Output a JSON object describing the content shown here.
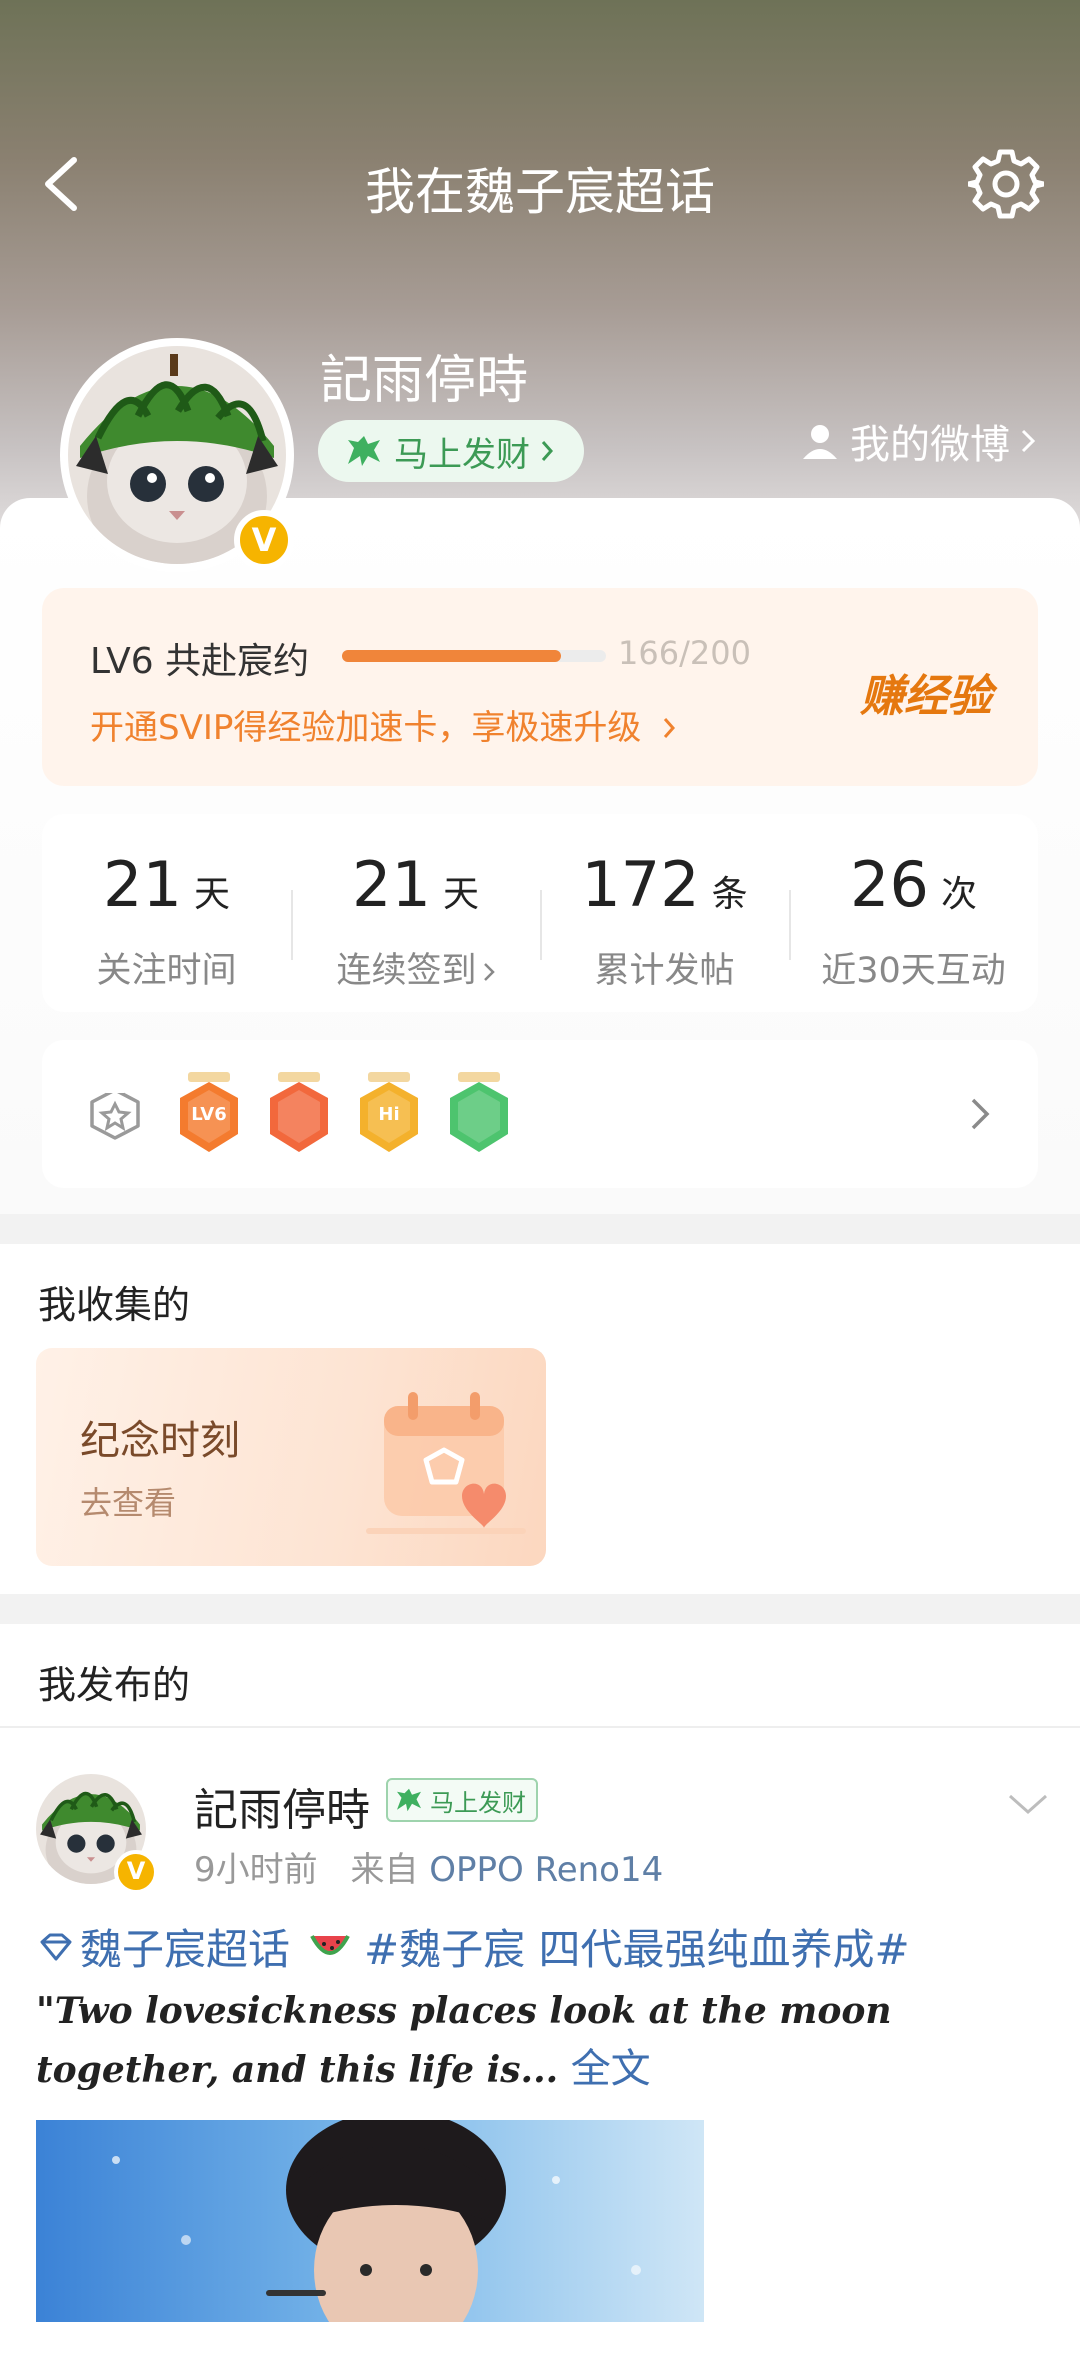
{
  "header": {
    "title": "我在魏子宸超话"
  },
  "profile": {
    "username": "記雨停時",
    "fortune_label": "马上发财",
    "my_weibo_label": "我的微博",
    "verified_glyph": "V"
  },
  "level": {
    "label": "LV6 共赴宸约",
    "progress_text": "166/200",
    "progress_current": 166,
    "progress_max": 200,
    "tip": "开通SVIP得经验加速卡，享极速升级",
    "earn_label": "赚经验"
  },
  "stats": [
    {
      "value": "21",
      "unit": "天",
      "label": "关注时间"
    },
    {
      "value": "21",
      "unit": "天",
      "label": "连续签到"
    },
    {
      "value": "172",
      "unit": "条",
      "label": "累计发帖"
    },
    {
      "value": "26",
      "unit": "次",
      "label": "近30天互动"
    }
  ],
  "medals": [
    {
      "icon": "lv6-medal-icon",
      "text": "LV6",
      "color": "#f47b2e"
    },
    {
      "icon": "rock-hand-medal-icon",
      "text": "",
      "color": "#f2683c"
    },
    {
      "icon": "hi-medal-icon",
      "text": "Hi",
      "color": "#f4b12c"
    },
    {
      "icon": "wave-hand-medal-icon",
      "text": "",
      "color": "#4dc46e"
    }
  ],
  "collected": {
    "section_title": "我收集的",
    "card_title": "纪念时刻",
    "card_sub": "去查看"
  },
  "posts": {
    "section_title": "我发布的",
    "post": {
      "author": "記雨停時",
      "badge": "马上发财",
      "time": "9小时前",
      "source_prefix": "来自",
      "source": "OPPO Reno14",
      "topic": "魏子宸超话",
      "hashtag": "#魏子宸 四代最强纯血养成#",
      "quote": "\"Two lovesickness places look at the moon together, and this life is...",
      "more_label": "全文"
    }
  },
  "colors": {
    "accent_orange": "#f0822e",
    "weibo_link": "#3f6fb0",
    "verified": "#f6b400",
    "fortune_green": "#3c9a55"
  }
}
